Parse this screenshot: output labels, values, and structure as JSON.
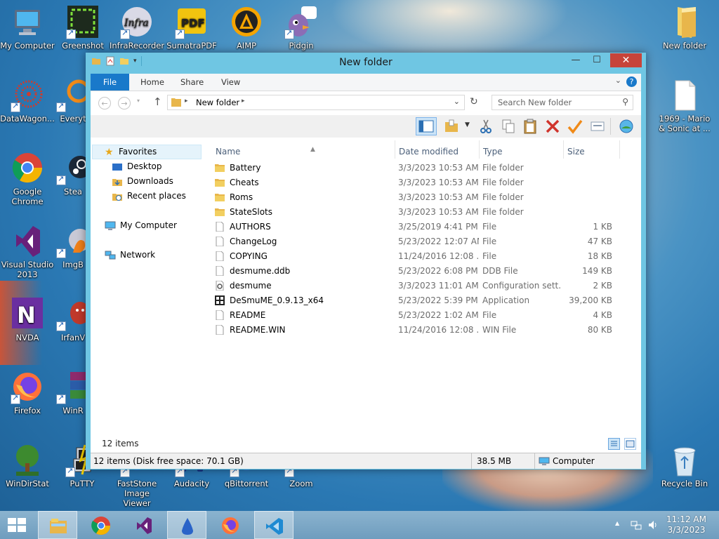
{
  "desktop": {
    "icons": [
      {
        "label": "My Computer"
      },
      {
        "label": "Greenshot"
      },
      {
        "label": "InfraRecorder"
      },
      {
        "label": "SumatraPDF"
      },
      {
        "label": "AIMP"
      },
      {
        "label": "Pidgin"
      },
      {
        "label": "New folder"
      },
      {
        "label": "DataWagon..."
      },
      {
        "label": "Everyt"
      },
      {
        "label": "1969 - Mario & Sonic at ..."
      },
      {
        "label": "Google Chrome"
      },
      {
        "label": "Stea"
      },
      {
        "label": "Visual Studio 2013"
      },
      {
        "label": "ImgB"
      },
      {
        "label": "NVDA"
      },
      {
        "label": "IrfanV"
      },
      {
        "label": "Firefox"
      },
      {
        "label": "WinR"
      },
      {
        "label": "WinDirStat"
      },
      {
        "label": "PuTTY"
      },
      {
        "label": "FastStone Image Viewer"
      },
      {
        "label": "Audacity"
      },
      {
        "label": "qBittorrent"
      },
      {
        "label": "Zoom"
      },
      {
        "label": "Recycle Bin"
      }
    ],
    "icon_logo_texts": {
      "infra": "Infra",
      "pdf": "PDF",
      "nvda": "N"
    }
  },
  "window": {
    "title": "New folder",
    "controls": {
      "minimize": "—",
      "maximize": "☐",
      "close": "✕"
    },
    "ribbon": {
      "tabs": [
        "File",
        "Home",
        "Share",
        "View"
      ],
      "help": "?"
    },
    "address": {
      "crumb": "New folder"
    },
    "search": {
      "placeholder": "Search New folder"
    },
    "nav": {
      "favorites": "Favorites",
      "items": [
        "Desktop",
        "Downloads",
        "Recent places"
      ],
      "computer": "My Computer",
      "network": "Network"
    },
    "columns": {
      "name": "Name",
      "date": "Date modified",
      "type": "Type",
      "size": "Size"
    },
    "files": [
      {
        "name": "Battery",
        "date": "3/3/2023 10:53 AM",
        "type": "File folder",
        "size": "",
        "icon": "folder-icon"
      },
      {
        "name": "Cheats",
        "date": "3/3/2023 10:53 AM",
        "type": "File folder",
        "size": "",
        "icon": "folder-icon"
      },
      {
        "name": "Roms",
        "date": "3/3/2023 10:53 AM",
        "type": "File folder",
        "size": "",
        "icon": "folder-icon"
      },
      {
        "name": "StateSlots",
        "date": "3/3/2023 10:53 AM",
        "type": "File folder",
        "size": "",
        "icon": "folder-icon"
      },
      {
        "name": "AUTHORS",
        "date": "3/25/2019 4:41 PM",
        "type": "File",
        "size": "1 KB",
        "icon": "file-icon"
      },
      {
        "name": "ChangeLog",
        "date": "5/23/2022 12:07 AM",
        "type": "File",
        "size": "47 KB",
        "icon": "file-icon"
      },
      {
        "name": "COPYING",
        "date": "11/24/2016 12:08 ...",
        "type": "File",
        "size": "18 KB",
        "icon": "file-icon"
      },
      {
        "name": "desmume.ddb",
        "date": "5/23/2022 6:08 PM",
        "type": "DDB File",
        "size": "149 KB",
        "icon": "file-icon"
      },
      {
        "name": "desmume",
        "date": "3/3/2023 11:01 AM",
        "type": "Configuration sett...",
        "size": "2 KB",
        "icon": "config-icon"
      },
      {
        "name": "DeSmuME_0.9.13_x64",
        "date": "5/23/2022 5:39 PM",
        "type": "Application",
        "size": "39,200 KB",
        "icon": "app-icon"
      },
      {
        "name": "README",
        "date": "5/23/2022 1:02 AM",
        "type": "File",
        "size": "4 KB",
        "icon": "file-icon"
      },
      {
        "name": "README.WIN",
        "date": "11/24/2016 12:08 ...",
        "type": "WIN File",
        "size": "80 KB",
        "icon": "file-icon"
      }
    ],
    "status": {
      "item_count": "12 items"
    },
    "details_bar": {
      "info": "12 items (Disk free space: 70.1 GB)",
      "size": "38.5 MB",
      "location": "Computer"
    }
  },
  "taskbar": {
    "clock_time": "11:12 AM",
    "clock_date": "3/3/2023",
    "tray_arrow": "▲"
  },
  "colors": {
    "accent": "#1979ca",
    "window_frame": "#6fc6e3",
    "close": "#c7443a",
    "folder": "#e8b64b"
  }
}
